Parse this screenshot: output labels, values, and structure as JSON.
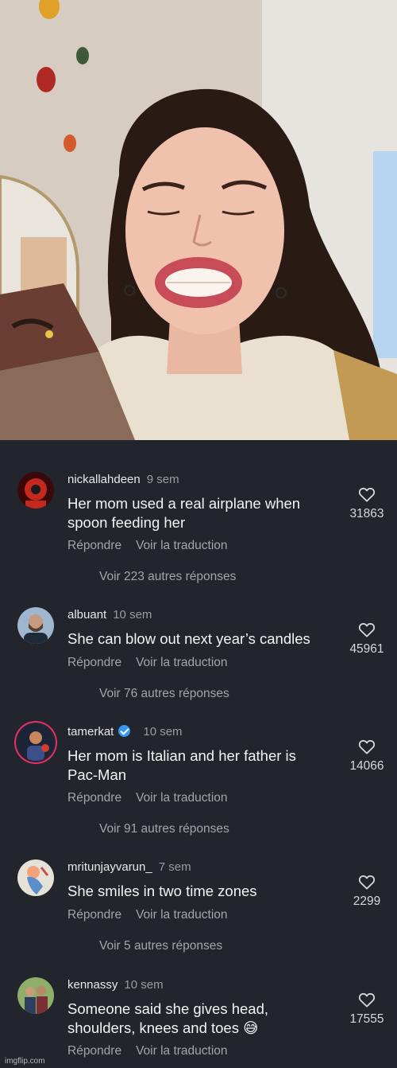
{
  "comments": [
    {
      "username": "nickallahdeen",
      "time": "9 sem",
      "text_lines": [
        "Her mom used a real airplane when",
        "spoon feeding her"
      ],
      "likes": "31863",
      "reply": "Répondre",
      "translate": "Voir la traduction",
      "more_replies": "Voir 223 autres réponses",
      "verified": false
    },
    {
      "username": "albuant",
      "time": "10 sem",
      "text_lines": [
        "She can blow out next year’s candles"
      ],
      "likes": "45961",
      "reply": "Répondre",
      "translate": "Voir la traduction",
      "more_replies": "Voir 76 autres réponses",
      "verified": false
    },
    {
      "username": "tamerkat",
      "time": "10 sem",
      "text_lines": [
        "Her mom is Italian and her father is",
        "Pac-Man"
      ],
      "likes": "14066",
      "reply": "Répondre",
      "translate": "Voir la traduction",
      "more_replies": "Voir 91 autres réponses",
      "verified": true
    },
    {
      "username": "mritunjayvarun_",
      "time": "7 sem",
      "text_lines": [
        "She smiles in two time zones"
      ],
      "likes": "2299",
      "reply": "Répondre",
      "translate": "Voir la traduction",
      "more_replies": "Voir 5 autres réponses",
      "verified": false
    },
    {
      "username": "kennassy",
      "time": "10 sem",
      "text_lines": [
        "Someone said she gives head,",
        "shoulders, knees and toes 😅"
      ],
      "likes": "17555",
      "reply": "Répondre",
      "translate": "Voir la traduction",
      "more_replies": "",
      "verified": false
    }
  ],
  "watermark": "imgflip.com",
  "colors": {
    "background": "#22252b",
    "text": "#f4f4f5",
    "muted": "#a3a5aa",
    "verified": "#3897f0"
  }
}
